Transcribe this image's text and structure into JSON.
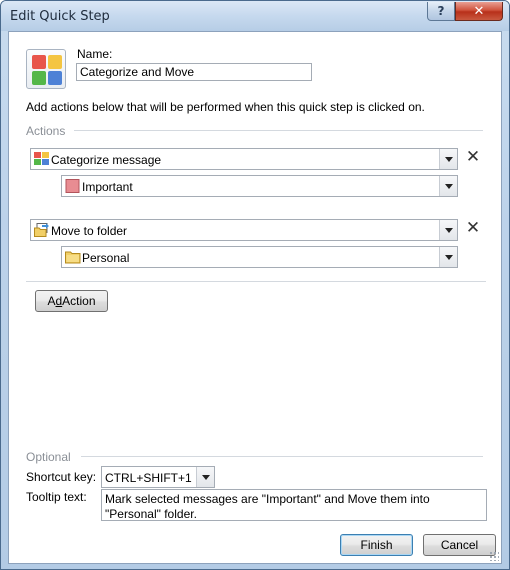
{
  "window": {
    "title": "Edit Quick Step",
    "help_glyph": "?",
    "close_glyph": "✕"
  },
  "name": {
    "label": "Name:",
    "value": "Categorize and Move"
  },
  "instruction": "Add actions below that will be performed when this quick step is clicked on.",
  "actions_section": {
    "title": "Actions",
    "actions": [
      {
        "action_label": "Categorize message",
        "action_icon": "categorize-icon",
        "option_label": "Important",
        "option_icon": "category-color-swatch",
        "option_color": "#e88c92"
      },
      {
        "action_label": "Move to folder",
        "action_icon": "move-to-folder-icon",
        "option_label": "Personal",
        "option_icon": "folder-icon",
        "option_color": "#f1cf67"
      }
    ],
    "remove_glyph": "✕",
    "add_action_label_prefix": "A",
    "add_action_label_underlined": "d",
    "add_action_label_rest": "d Action"
  },
  "optional_section": {
    "title": "Optional",
    "shortcut_label": "Shortcut key:",
    "shortcut_value": "CTRL+SHIFT+1",
    "tooltip_label": "Tooltip text:",
    "tooltip_value": "Mark selected messages are \"Important\" and Move them into \"Personal\" folder."
  },
  "buttons": {
    "finish": "Finish",
    "cancel": "Cancel"
  },
  "colors": {
    "title_bar": "#c6d9ee",
    "close_button": "#c9432d",
    "default_button_border": "#3c7fb1"
  }
}
